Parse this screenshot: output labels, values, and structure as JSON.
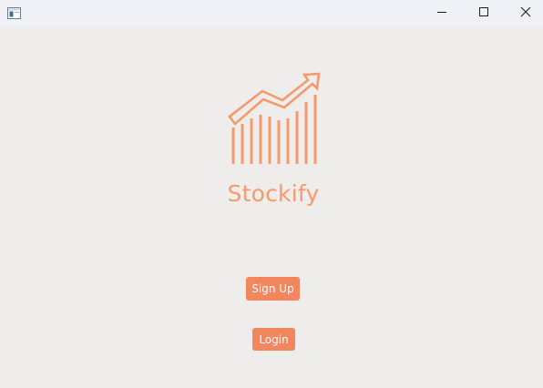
{
  "window": {
    "title": "",
    "controls": {
      "minimize_icon": "minimize-icon",
      "maximize_icon": "maximize-icon",
      "close_icon": "close-icon"
    }
  },
  "app": {
    "name": "Stockify",
    "logo_icon": "stock-growth-chart-icon",
    "accent_color": "#f6996b",
    "button_color": "#f1865f"
  },
  "actions": {
    "signup_label": "Sign Up",
    "login_label": "Login"
  }
}
